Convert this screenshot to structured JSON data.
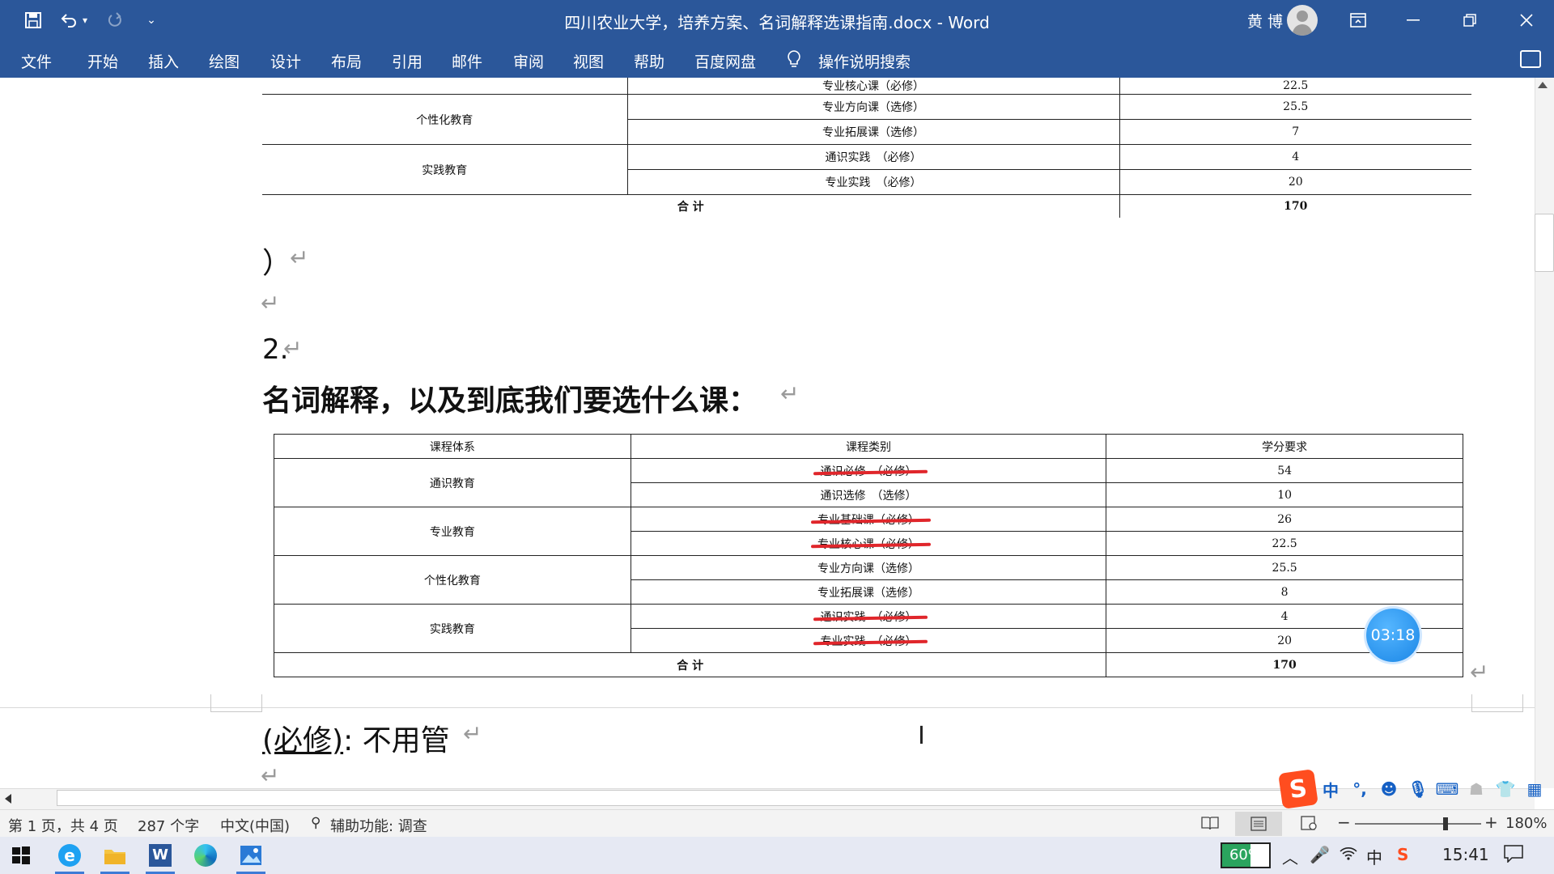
{
  "window": {
    "title": "四川农业大学，培养方案、名词解释选课指南.docx  -  Word",
    "user": "黄 博"
  },
  "ribbon": {
    "tabs": [
      "文件",
      "开始",
      "插入",
      "绘图",
      "设计",
      "布局",
      "引用",
      "邮件",
      "审阅",
      "视图",
      "帮助",
      "百度网盘"
    ],
    "tell_me": "操作说明搜索"
  },
  "document": {
    "table1": {
      "rows": [
        {
          "system": "",
          "category": "专业核心课（必修）",
          "credit": "22.5"
        },
        {
          "system": "个性化教育",
          "category": "专业方向课（选修）",
          "credit": "25.5"
        },
        {
          "system": "",
          "category": "专业拓展课（选修）",
          "credit": "7"
        },
        {
          "system": "实践教育",
          "category": "通识实践　（必修）",
          "credit": "4"
        },
        {
          "system": "",
          "category": "专业实践　（必修）",
          "credit": "20"
        }
      ],
      "total_label": "合 计",
      "total_value": "170"
    },
    "paren_line": "）",
    "section_number": "2.",
    "heading": "名词解释，以及到底我们要选什么课：",
    "table2": {
      "headers": [
        "课程体系",
        "课程类别",
        "学分要求"
      ],
      "groups": [
        "通识教育",
        "专业教育",
        "个性化教育",
        "实践教育"
      ],
      "rows": [
        {
          "category": "通识必修　（必修）",
          "credit": "54",
          "struck": true
        },
        {
          "category": "通识选修　（选修）",
          "credit": "10",
          "struck": false
        },
        {
          "category": "专业基础课（必修）",
          "credit": "26",
          "struck": true
        },
        {
          "category": "专业核心课（必修）",
          "credit": "22.5",
          "struck": true
        },
        {
          "category": "专业方向课（选修）",
          "credit": "25.5",
          "struck": false
        },
        {
          "category": "专业拓展课（选修）",
          "credit": "8",
          "struck": false
        },
        {
          "category": "通识实践　（必修）",
          "credit": "4",
          "struck": true
        },
        {
          "category": "专业实践　（必修）",
          "credit": "20",
          "struck": true
        }
      ],
      "total_label": "合 计",
      "total_value": "170"
    },
    "next_para_prefix": "(必修)",
    "next_para_rest": ":  不用管"
  },
  "timer": "03:18",
  "ime": {
    "mode": "中"
  },
  "statusbar": {
    "page": "第 1 页，共 4 页",
    "words": "287 个字",
    "language": "中文(中国)",
    "accessibility": "辅助功能: 调查",
    "zoom": "180%",
    "zoom_level": 0.72
  },
  "taskbar": {
    "battery": "60%",
    "battery_level": 0.6,
    "ime": "中",
    "time": "15:41"
  },
  "colors": {
    "word_blue": "#2b579a",
    "annotation_red": "#e0262b",
    "timer_blue": "#1a86e6"
  }
}
